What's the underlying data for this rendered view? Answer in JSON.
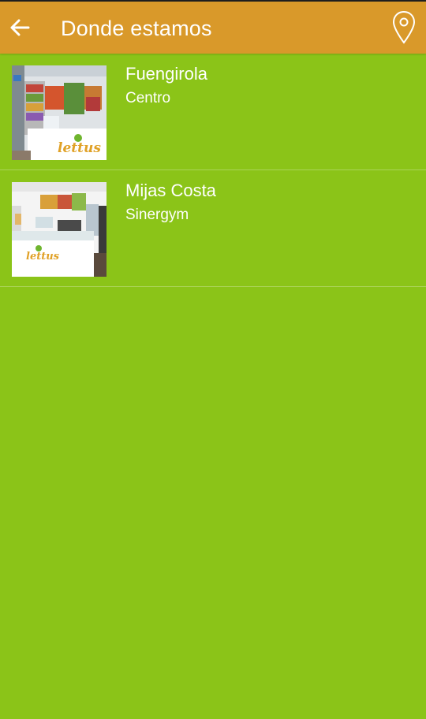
{
  "app_bar": {
    "title": "Donde estamos",
    "back_icon": "arrow-left-icon",
    "map_icon": "map-pin-icon",
    "color": "#d9992a"
  },
  "theme": {
    "background": "#8bc418",
    "text": "#ffffff"
  },
  "locations": [
    {
      "title": "Fuengirola",
      "subtitle": "Centro"
    },
    {
      "title": "Mijas Costa",
      "subtitle": "Sinergym"
    }
  ]
}
